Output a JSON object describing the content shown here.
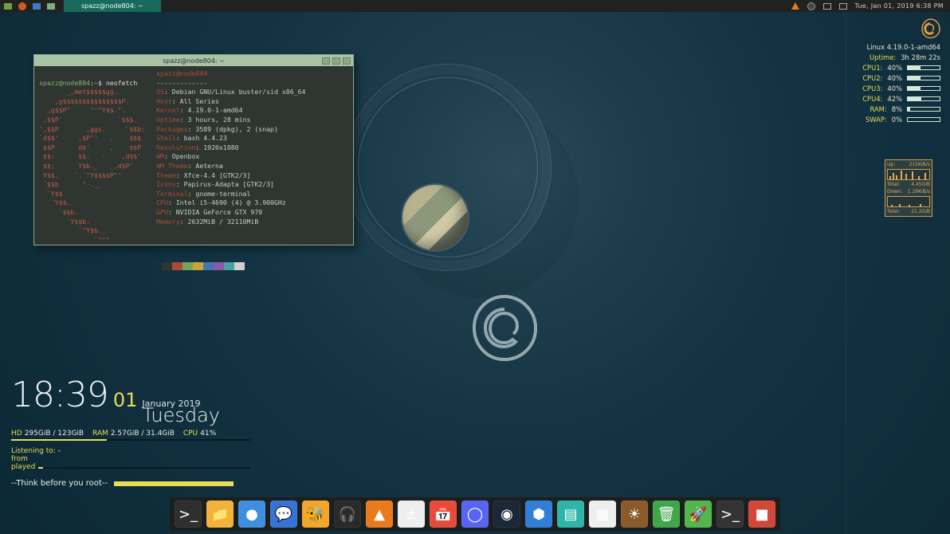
{
  "topbar": {
    "task_label": "spazz@node804: ~",
    "datetime": "Tue, Jan 01, 2019   6:38 PM"
  },
  "terminal": {
    "title": "spazz@node804: ~",
    "prompt_user": "spazz@node804",
    "prompt_sep": ":",
    "prompt_path": "~",
    "prompt_sym": "$",
    "command": "neofetch",
    "header": "spazz@node804",
    "header_rule": "-------------",
    "ascii": "       _,met$$$$$gg.\n    ,g$$$$$$$$$$$$$$$P.\n  ,g$$P\"     \"\"\"Y$$.\".\n ,$$P'              `$$$.\n',$$P       ,ggs.     `$$b:\n`d$$'     ,$P\"'   .    $$$\n $$P      d$'     ,    $$P\n $$:      $$.   -    ,d$$'\n $$;      Y$b._   _,d$P'\n Y$$.    `.`\"Y$$$$P\"'\n `$$b      \"-.__\n  `Y$$\n   `Y$$.\n     `$$b.\n       `Y$$b.\n          `\"Y$b._\n              `\"\"\"",
    "info": [
      {
        "k": "OS",
        "v": "Debian GNU/Linux buster/sid x86_64"
      },
      {
        "k": "Host",
        "v": "All Series"
      },
      {
        "k": "Kernel",
        "v": "4.19.0-1-amd64"
      },
      {
        "k": "Uptime",
        "v": "3 hours, 28 mins"
      },
      {
        "k": "Packages",
        "v": "3589 (dpkg), 2 (snap)"
      },
      {
        "k": "Shell",
        "v": "bash 4.4.23"
      },
      {
        "k": "Resolution",
        "v": "1920x1080"
      },
      {
        "k": "WM",
        "v": "Openbox"
      },
      {
        "k": "WM Theme",
        "v": "Aeterna"
      },
      {
        "k": "Theme",
        "v": "Xfce-4.4 [GTK2/3]"
      },
      {
        "k": "Icons",
        "v": "Papirus-Adapta [GTK2/3]"
      },
      {
        "k": "Terminal",
        "v": "gnome-terminal"
      },
      {
        "k": "CPU",
        "v": "Intel i5-4690 (4) @ 3.900GHz"
      },
      {
        "k": "GPU",
        "v": "NVIDIA GeForce GTX 970"
      },
      {
        "k": "Memory",
        "v": "2632MiB / 32110MiB"
      }
    ],
    "swatches": [
      "#2f3530",
      "#a84b3a",
      "#7aa25a",
      "#c9a23a",
      "#4574b4",
      "#8a5aa8",
      "#4aa2a2",
      "#d0d0d0"
    ]
  },
  "clock": {
    "time": "18:39",
    "daynum": "01",
    "monthyear": "January 2019",
    "weekday": "Tuesday",
    "hd_label": "HD",
    "hd_value": "295GiB / 123GiB",
    "ram_label": "RAM",
    "ram_value": "2.57GiB / 31.4GiB",
    "cpu_label": "CPU",
    "cpu_value": "41%",
    "listening_label": "Listening to:",
    "listening_value": "-",
    "from_label": "from",
    "played_label": "played",
    "quote": "--Think before you root--"
  },
  "sys": {
    "kernel": "Linux 4.19.0-1-amd64",
    "uptime_label": "Uptime:",
    "uptime_value": "3h 28m 22s",
    "rows": [
      {
        "k": "CPU1:",
        "v": "40%",
        "p": 40
      },
      {
        "k": "CPU2:",
        "v": "40%",
        "p": 40
      },
      {
        "k": "CPU3:",
        "v": "40%",
        "p": 40
      },
      {
        "k": "CPU4:",
        "v": "42%",
        "p": 42
      },
      {
        "k": "RAM:",
        "v": "8%",
        "p": 8
      },
      {
        "k": "SWAP:",
        "v": "0%",
        "p": 0
      }
    ]
  },
  "net": {
    "up_label": "Up:",
    "up_value": "215KiB/s",
    "up_total_label": "Total:",
    "up_total_value": "4.45GiB",
    "down_label": "Down:",
    "down_value": "1.29KiB/s",
    "down_total_label": "Total:",
    "down_total_value": "21.2GiB"
  },
  "dock": {
    "items": [
      {
        "name": "terminal",
        "glyph": ">_"
      },
      {
        "name": "files",
        "glyph": "📁"
      },
      {
        "name": "chromium",
        "glyph": "●"
      },
      {
        "name": "signal",
        "glyph": "💬"
      },
      {
        "name": "honey",
        "glyph": "🐝"
      },
      {
        "name": "headphones",
        "glyph": "🎧"
      },
      {
        "name": "vlc",
        "glyph": "▲"
      },
      {
        "name": "calculator",
        "glyph": "±"
      },
      {
        "name": "calendar",
        "glyph": "📅"
      },
      {
        "name": "discord",
        "glyph": "◯"
      },
      {
        "name": "steam",
        "glyph": "◉"
      },
      {
        "name": "octopi",
        "glyph": "⬢"
      },
      {
        "name": "task-manager",
        "glyph": "▤"
      },
      {
        "name": "color-picker",
        "glyph": "▦"
      },
      {
        "name": "weather",
        "glyph": "☀"
      },
      {
        "name": "trash",
        "glyph": "🗑"
      },
      {
        "name": "launcher",
        "glyph": "🚀"
      },
      {
        "name": "terminal-alt",
        "glyph": ">_"
      },
      {
        "name": "shutdown",
        "glyph": "■"
      }
    ]
  }
}
